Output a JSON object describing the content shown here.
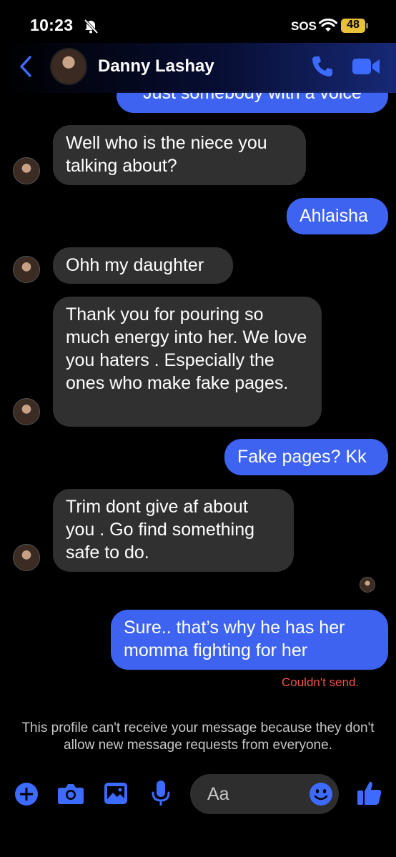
{
  "status_bar": {
    "time": "10:23",
    "sos": "SOS",
    "battery": "48"
  },
  "header": {
    "contact_name": "Danny Lashay"
  },
  "messages": [
    {
      "dir": "out",
      "text": "Just somebody with a voice"
    },
    {
      "dir": "in",
      "text": "Well who is the niece you talking about?"
    },
    {
      "dir": "out",
      "text": "Ahlaisha"
    },
    {
      "dir": "in",
      "text": "Ohh my daughter"
    },
    {
      "dir": "in",
      "text": "Thank you for pouring so much energy into her. We love you haters . Especially the ones who make fake pages."
    },
    {
      "dir": "out",
      "text": "Fake pages? Kk"
    },
    {
      "dir": "in",
      "text": "Trim dont give af about you . Go find something safe to do."
    },
    {
      "dir": "out",
      "text": "Sure.. that’s why he has her momma fighting for her"
    }
  ],
  "error_text": "Couldn't send.",
  "notice_text": "This profile can't receive your message because they don't allow new message requests from everyone.",
  "composer": {
    "placeholder": "Aa"
  },
  "colors": {
    "accent": "#3d63f0",
    "incoming_bubble": "#303030",
    "error": "#f0524f"
  }
}
